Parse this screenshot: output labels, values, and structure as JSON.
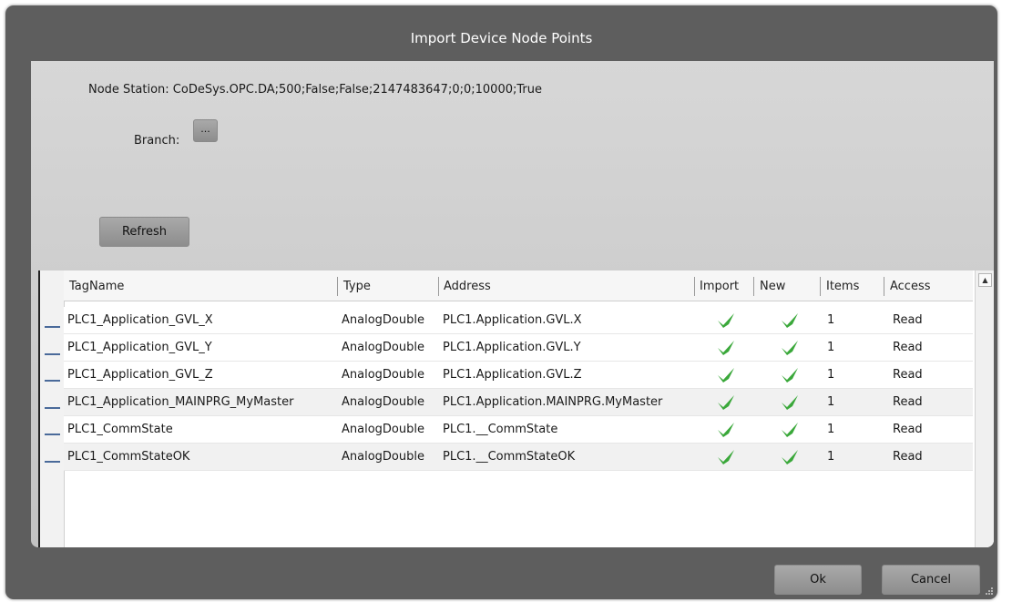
{
  "dialog": {
    "title": "Import Device Node Points",
    "node_station_label": "Node Station: CoDeSys.OPC.DA;500;False;False;2147483647;0;0;10000;True",
    "branch_label": "Branch:",
    "branch_button": "...",
    "refresh_button": "Refresh",
    "ok_button": "Ok",
    "cancel_button": "Cancel"
  },
  "table": {
    "columns": [
      "TagName",
      "Type",
      "Address",
      "Import",
      "New",
      "Items",
      "Access"
    ],
    "rows": [
      {
        "tagname": "PLC1_Application_GVL_X",
        "type": "AnalogDouble",
        "address": "PLC1.Application.GVL.X",
        "import": true,
        "new": true,
        "items": "1",
        "access": "Read"
      },
      {
        "tagname": "PLC1_Application_GVL_Y",
        "type": "AnalogDouble",
        "address": "PLC1.Application.GVL.Y",
        "import": true,
        "new": true,
        "items": "1",
        "access": "Read"
      },
      {
        "tagname": "PLC1_Application_GVL_Z",
        "type": "AnalogDouble",
        "address": "PLC1.Application.GVL.Z",
        "import": true,
        "new": true,
        "items": "1",
        "access": "Read"
      },
      {
        "tagname": "PLC1_Application_MAINPRG_MyMaster",
        "type": "AnalogDouble",
        "address": "PLC1.Application.MAINPRG.MyMaster",
        "import": true,
        "new": true,
        "items": "1",
        "access": "Read"
      },
      {
        "tagname": "PLC1_CommState",
        "type": "AnalogDouble",
        "address": "PLC1.__CommState",
        "import": true,
        "new": true,
        "items": "1",
        "access": "Read"
      },
      {
        "tagname": "PLC1_CommStateOK",
        "type": "AnalogDouble",
        "address": "PLC1.__CommStateOK",
        "import": true,
        "new": true,
        "items": "1",
        "access": "Read"
      }
    ]
  },
  "icons": {
    "check": "check-icon",
    "scroll_up": "scroll-up-arrow-icon",
    "resize": "resize-grip-icon"
  },
  "colors": {
    "dialog_bg": "#5e5e5e",
    "panel_bg": "#cfcfcf",
    "check_green": "#3aa83a",
    "row_marker": "#4a6a9a"
  }
}
